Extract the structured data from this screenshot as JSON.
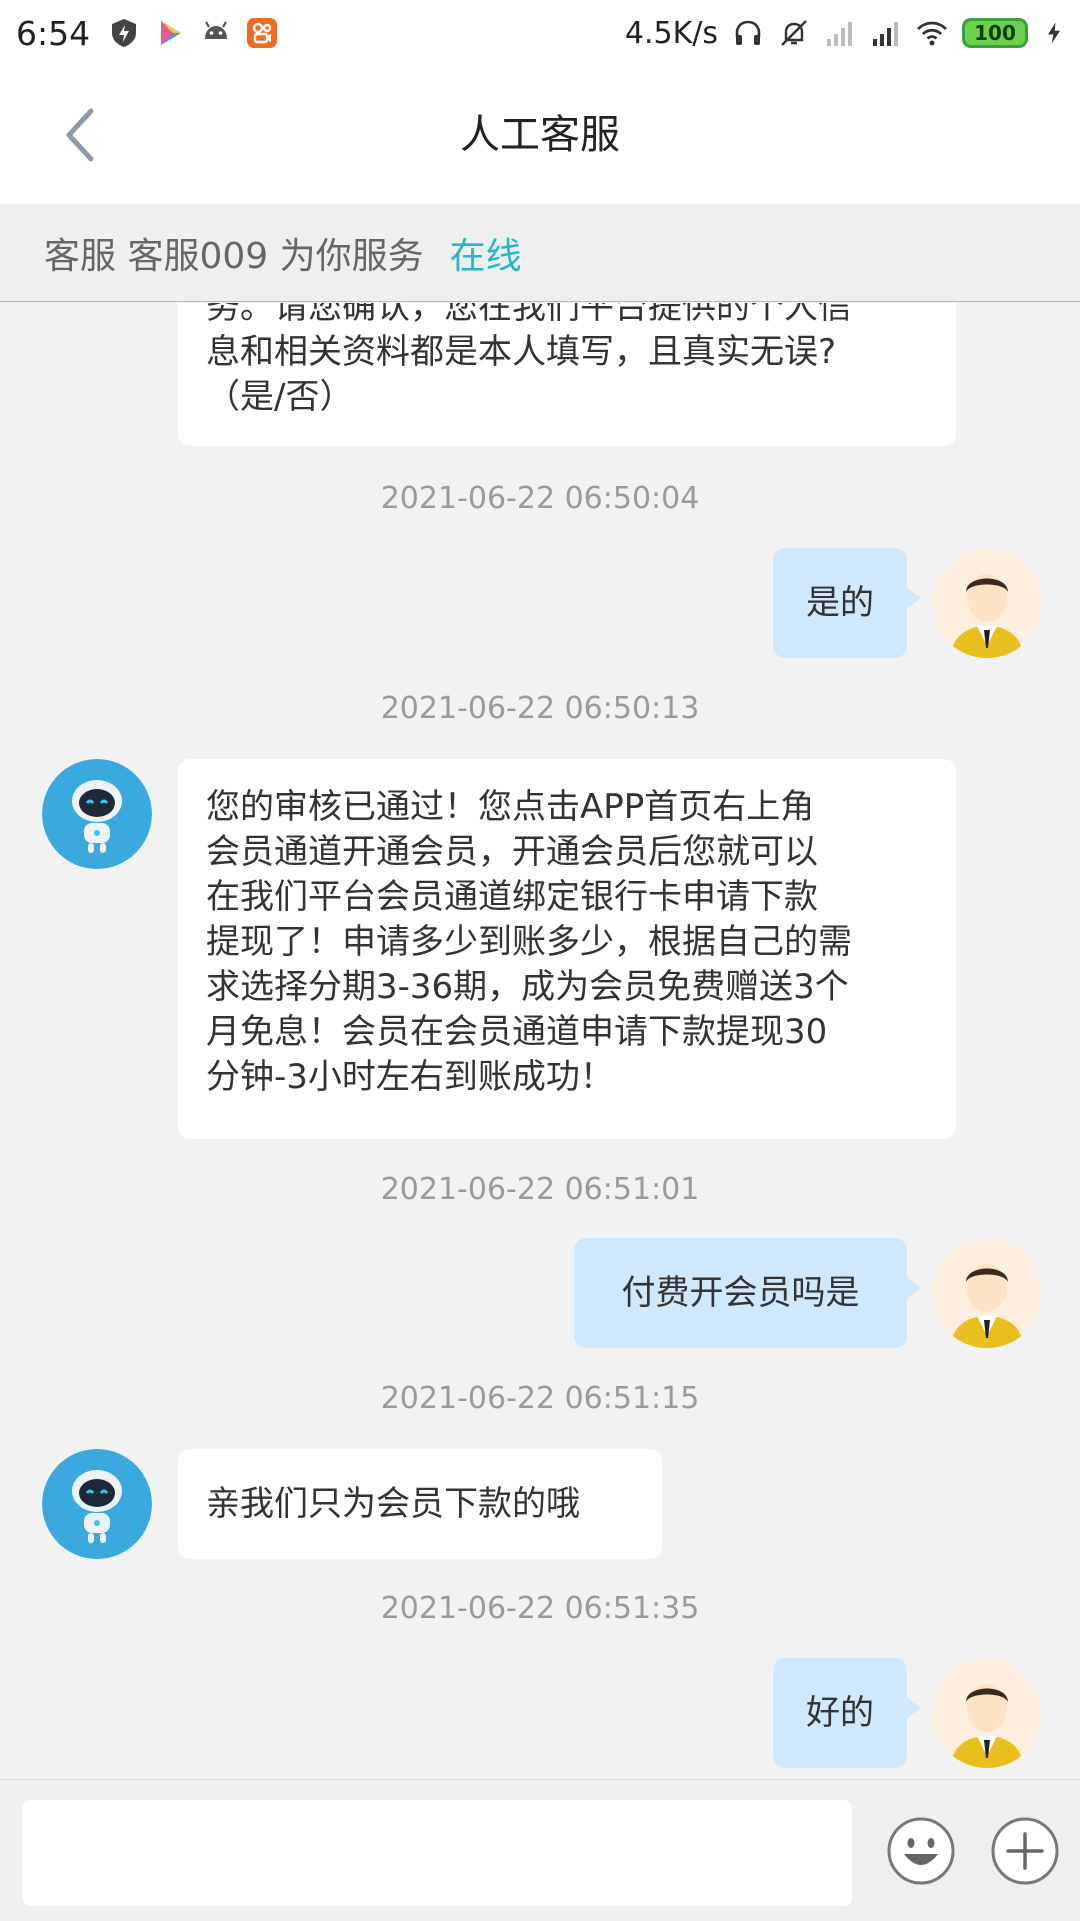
{
  "status": {
    "time": "6:54",
    "speed": "4.5K/s",
    "battery": "100",
    "left_icons": [
      "shield-bolt-icon",
      "play-store-icon",
      "android-icon",
      "kuaishou-app-icon"
    ],
    "right_icons": [
      "headphones-icon",
      "bell-off-icon",
      "signal-icon",
      "signal-icon",
      "wifi-icon",
      "charging-icon"
    ]
  },
  "header": {
    "title": "人工客服",
    "back_icon": "chevron-left-icon"
  },
  "agent_bar": {
    "text": "客服 客服009 为你服务",
    "status": "在线",
    "status_color": "#26b6c9"
  },
  "messages": {
    "m0": {
      "side": "left",
      "lines": [
        "务。请您确认，您在我们平台提供的个人信",
        "息和相关资料都是本人填写，且真实无误?",
        "（是/否）"
      ]
    },
    "t1": "2021-06-22 06:50:04",
    "m1": {
      "side": "right",
      "text": "是的"
    },
    "t2": "2021-06-22 06:50:13",
    "m2": {
      "side": "left",
      "lines": [
        "您的审核已通过！您点击APP首页右上角",
        "会员通道开通会员，开通会员后您就可以",
        "在我们平台会员通道绑定银行卡申请下款",
        "提现了！申请多少到账多少，根据自己的需",
        "求选择分期3-36期，成为会员免费赠送3个",
        "月免息！会员在会员通道申请下款提现30",
        "分钟-3小时左右到账成功！"
      ]
    },
    "t3": "2021-06-22 06:51:01",
    "m3": {
      "side": "right",
      "text": "付费开会员吗是"
    },
    "t4": "2021-06-22 06:51:15",
    "m4": {
      "side": "left",
      "text": "亲我们只为会员下款的哦"
    },
    "t5": "2021-06-22 06:51:35",
    "m5": {
      "side": "right",
      "text": "好的"
    }
  },
  "avatars": {
    "agent": "robot-avatar-icon",
    "user": "man-avatar-icon"
  },
  "input_bar": {
    "placeholder": "",
    "emoji_icon": "emoji-icon",
    "plus_icon": "plus-icon"
  },
  "colors": {
    "user_bubble": "#cfe8fb",
    "agent_bubble": "#ffffff",
    "background": "#f2f2f2"
  }
}
